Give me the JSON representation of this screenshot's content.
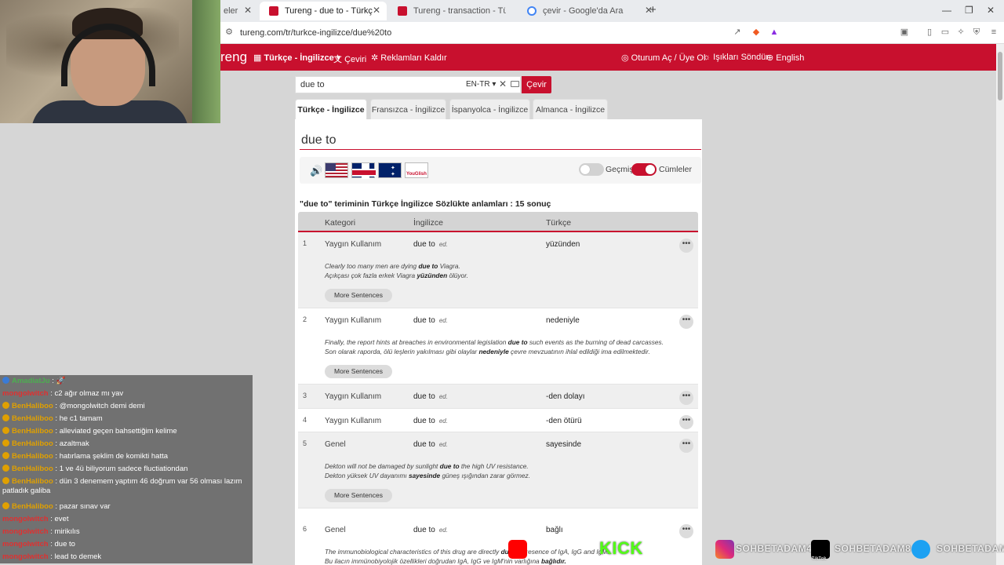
{
  "browser": {
    "tabs": [
      {
        "label": "eler"
      },
      {
        "label": "Tureng - due to - Türkçe İngilizce"
      },
      {
        "label": "Tureng - transaction - Türkçe İngilizce"
      },
      {
        "label": "çevir - Google'da Ara"
      }
    ],
    "url": "tureng.com/tr/turkce-ingilizce/due%20to"
  },
  "header": {
    "logo": "reng",
    "dict_menu": "Türkçe - İngilizce",
    "translate": "Çeviri",
    "remove_ads": "Reklamları Kaldır",
    "login": "Oturum Aç / Üye Ol",
    "lights_off": "Işıkları Söndür",
    "language": "English"
  },
  "search": {
    "value": "due to",
    "lang": "EN-TR",
    "button": "Çevir"
  },
  "lang_tabs": [
    "Türkçe - İngilizce",
    "Fransızca - İngilizce",
    "İspanyolca - İngilizce",
    "Almanca - İngilizce"
  ],
  "term": "due to",
  "toggles": {
    "history": "Geçmiş",
    "sentences": "Cümleler"
  },
  "youglish": "YouGlish",
  "result_count": "\"due to\" teriminin Türkçe İngilizce Sözlükte anlamları : 15 sonuç",
  "table": {
    "headers": {
      "category": "Kategori",
      "english": "İngilizce",
      "turkish": "Türkçe"
    },
    "more_sentences": "More Sentences",
    "rows": [
      {
        "num": "1",
        "category": "Yaygın Kullanım",
        "english": "due to",
        "pos": "ed.",
        "turkish": "yüzünden",
        "ex_en_pre": "Clearly too many men are dying ",
        "ex_en_b": "due to",
        "ex_en_post": " Viagra.",
        "ex_tr_pre": "Açıkçası çok fazla erkek Viagra ",
        "ex_tr_b": "yüzünden",
        "ex_tr_post": " ölüyor."
      },
      {
        "num": "2",
        "category": "Yaygın Kullanım",
        "english": "due to",
        "pos": "ed.",
        "turkish": "nedeniyle",
        "ex_en_pre": "Finally, the report hints at breaches in environmental legislation ",
        "ex_en_b": "due to",
        "ex_en_post": " such events as the burning of dead carcasses.",
        "ex_tr_pre": "Son olarak raporda, ölü leşlerin yakılması gibi olaylar ",
        "ex_tr_b": "nedeniyle",
        "ex_tr_post": " çevre mevzuatının ihlal edildiği ima edilmektedir."
      },
      {
        "num": "3",
        "category": "Yaygın Kullanım",
        "english": "due to",
        "pos": "ed.",
        "turkish": "-den dolayı"
      },
      {
        "num": "4",
        "category": "Yaygın Kullanım",
        "english": "due to",
        "pos": "ed.",
        "turkish": "-den ötürü"
      },
      {
        "num": "5",
        "category": "Genel",
        "english": "due to",
        "pos": "ed.",
        "turkish": "sayesinde",
        "ex_en_pre": "Dekton will not be damaged by sunlight ",
        "ex_en_b": "due to",
        "ex_en_post": " the high UV resistance.",
        "ex_tr_pre": "Dekton yüksek UV dayanımı ",
        "ex_tr_b": "sayesinde",
        "ex_tr_post": " güneş ışığından zarar görmez."
      },
      {
        "num": "6",
        "category": "Genel",
        "english": "due to",
        "pos": "ed.",
        "turkish": "bağlı",
        "ex_en_pre": "The immunobiological characteristics of this drug are directly ",
        "ex_en_b": "due to",
        "ex_en_post": " presence of IgA, IgG and IgM.",
        "ex_tr_pre": "Bu ilacın immünobiyolojik özellikleri doğrudan IgA, IgG ve IgM'nin varlığına ",
        "ex_tr_b": "bağlıdır.",
        "ex_tr_post": ""
      }
    ]
  },
  "chat": [
    {
      "user": "AmadiatJu",
      "msg": ": 🚀",
      "color": "#4caf50"
    },
    {
      "user": "mongolwitch",
      "msg": ": c2 ağır olmaz mı yav",
      "color": "#e03030"
    },
    {
      "user": "BenHaliboo",
      "msg": ": @mongolwitch demi demi",
      "color": "#e0a000"
    },
    {
      "user": "BenHaliboo",
      "msg": ": he c1 tamam",
      "color": "#e0a000"
    },
    {
      "user": "BenHaliboo",
      "msg": ": alleviated geçen bahsettiğim kelime",
      "color": "#e0a000"
    },
    {
      "user": "BenHaliboo",
      "msg": ": azaltmak",
      "color": "#e0a000"
    },
    {
      "user": "BenHaliboo",
      "msg": ": hatırlama şeklim de komikti hatta",
      "color": "#e0a000"
    },
    {
      "user": "BenHaliboo",
      "msg": ": 1 ve 4ü biliyorum sadece fluctiationdan",
      "color": "#e0a000"
    },
    {
      "user": "BenHaliboo",
      "msg": ": dün 3 denemem yaptım 46 doğrum var 56 olması lazım",
      "msg2": "patladık galiba",
      "color": "#e0a000"
    },
    {
      "user": "BenHaliboo",
      "msg": ": pazar sınav var",
      "color": "#e0a000"
    },
    {
      "user": "mongolwitch",
      "msg": ": evet",
      "color": "#e03030"
    },
    {
      "user": "mongolwitch",
      "msg": ": mirikılıs",
      "color": "#e03030"
    },
    {
      "user": "mongolwitch",
      "msg": ": due to",
      "color": "#e03030"
    },
    {
      "user": "mongolwitch",
      "msg": ": lead to demek",
      "color": "#e03030"
    }
  ],
  "social": {
    "kick": "KICK",
    "instagram": "SOHBETADAM4",
    "tiktok": "SOHBETADAM8",
    "twitter": "SOHBETADAM",
    "tiktok_label": "TikTok"
  },
  "colors": {
    "brand": "#c8102e"
  }
}
